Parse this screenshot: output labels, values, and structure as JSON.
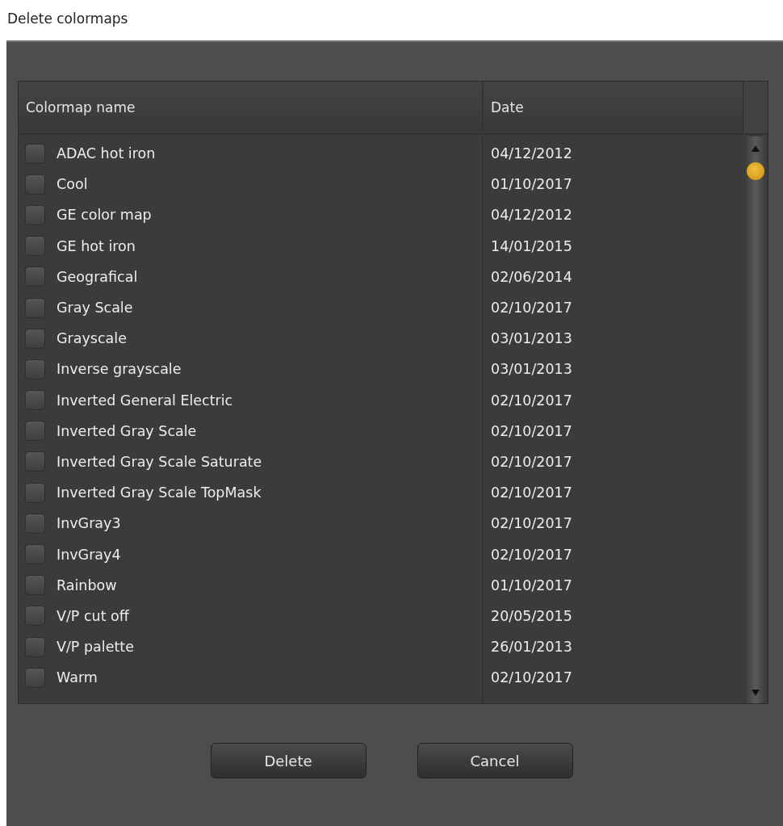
{
  "window": {
    "title": "Delete colormaps"
  },
  "table": {
    "columns": [
      "Colormap name",
      "Date"
    ],
    "rows": [
      {
        "name": "ADAC hot iron",
        "date": "04/12/2012",
        "checked": false
      },
      {
        "name": "Cool",
        "date": "01/10/2017",
        "checked": false
      },
      {
        "name": "GE color map",
        "date": "04/12/2012",
        "checked": false
      },
      {
        "name": "GE hot iron",
        "date": "14/01/2015",
        "checked": false
      },
      {
        "name": "Geografical",
        "date": "02/06/2014",
        "checked": false
      },
      {
        "name": "Gray Scale",
        "date": "02/10/2017",
        "checked": false
      },
      {
        "name": "Grayscale",
        "date": "03/01/2013",
        "checked": false
      },
      {
        "name": "Inverse grayscale",
        "date": "03/01/2013",
        "checked": false
      },
      {
        "name": "Inverted General Electric",
        "date": "02/10/2017",
        "checked": false
      },
      {
        "name": "Inverted Gray Scale",
        "date": "02/10/2017",
        "checked": false
      },
      {
        "name": "Inverted Gray Scale Saturate",
        "date": "02/10/2017",
        "checked": false
      },
      {
        "name": "Inverted Gray Scale TopMask",
        "date": "02/10/2017",
        "checked": false
      },
      {
        "name": "InvGray3",
        "date": "02/10/2017",
        "checked": false
      },
      {
        "name": "InvGray4",
        "date": "02/10/2017",
        "checked": false
      },
      {
        "name": "Rainbow",
        "date": "01/10/2017",
        "checked": false
      },
      {
        "name": "V/P cut off",
        "date": "20/05/2015",
        "checked": false
      },
      {
        "name": "V/P palette",
        "date": "26/01/2013",
        "checked": false
      },
      {
        "name": "Warm",
        "date": "02/10/2017",
        "checked": false
      }
    ]
  },
  "buttons": [
    "Delete",
    "Cancel"
  ]
}
